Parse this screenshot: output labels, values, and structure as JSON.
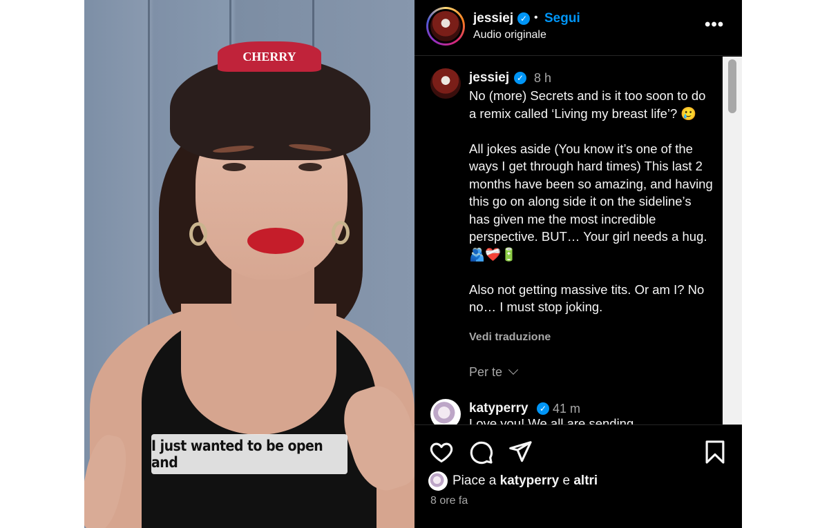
{
  "video": {
    "caption": "I just wanted to be open and",
    "cap_text": "CHERRY"
  },
  "header": {
    "username": "jessiej",
    "verified_icon": "verified-badge-icon",
    "separator": "•",
    "follow_label": "Segui",
    "audio_label": "Audio originale",
    "more_icon": "more-options-icon"
  },
  "post": {
    "author": "jessiej",
    "time": "8 h",
    "text": "No (more) Secrets and is it too soon to do a remix called ‘Living my breast life’? 🥲\n\nAll jokes aside (You know it’s one of the ways I get through hard times) This last 2 months have been so amazing, and having this go on along side it on the sideline’s has given me the most incredible perspective. BUT… Your girl needs a hug. 🫂❤️‍🩹🔋\n\nAlso not getting massive tits. Or am I? No no… I must stop joking.",
    "translate_label": "Vedi traduzione",
    "for_you_label": "Per te"
  },
  "comment": {
    "author": "katyperry",
    "time": "41 m",
    "text": "Love you! We all are sending"
  },
  "actions": {
    "like_icon": "heart-icon",
    "comment_icon": "comment-icon",
    "share_icon": "share-icon",
    "save_icon": "bookmark-icon",
    "likes_prefix": "Piace a ",
    "likes_user": "katyperry",
    "likes_middle": " e ",
    "likes_others": "altri",
    "time_ago": "8 ore fa"
  },
  "colors": {
    "accent": "#0095f6",
    "background": "#000000",
    "secondary_text": "#a8a8a8"
  }
}
